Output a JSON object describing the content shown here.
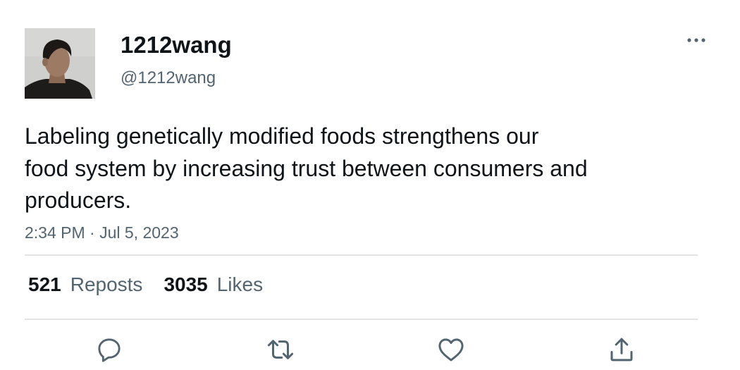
{
  "user": {
    "display_name": "1212wang",
    "handle": "@1212wang"
  },
  "tweet": {
    "text_lines": [
      "Labeling genetically modified foods strengthens our",
      "food system by increasing trust between consumers and",
      "producers."
    ],
    "timestamp": "2:34 PM · Jul 5, 2023"
  },
  "stats": {
    "reposts_count": "521",
    "reposts_label": "Reposts",
    "likes_count": "3035",
    "likes_label": "Likes"
  },
  "icons": {
    "more": "more-dots-icon",
    "reply": "reply-icon",
    "repost": "repost-icon",
    "like": "heart-icon",
    "share": "share-icon"
  },
  "colors": {
    "text": "#0f1419",
    "secondary": "#536471",
    "divider": "#e1e3e5"
  }
}
